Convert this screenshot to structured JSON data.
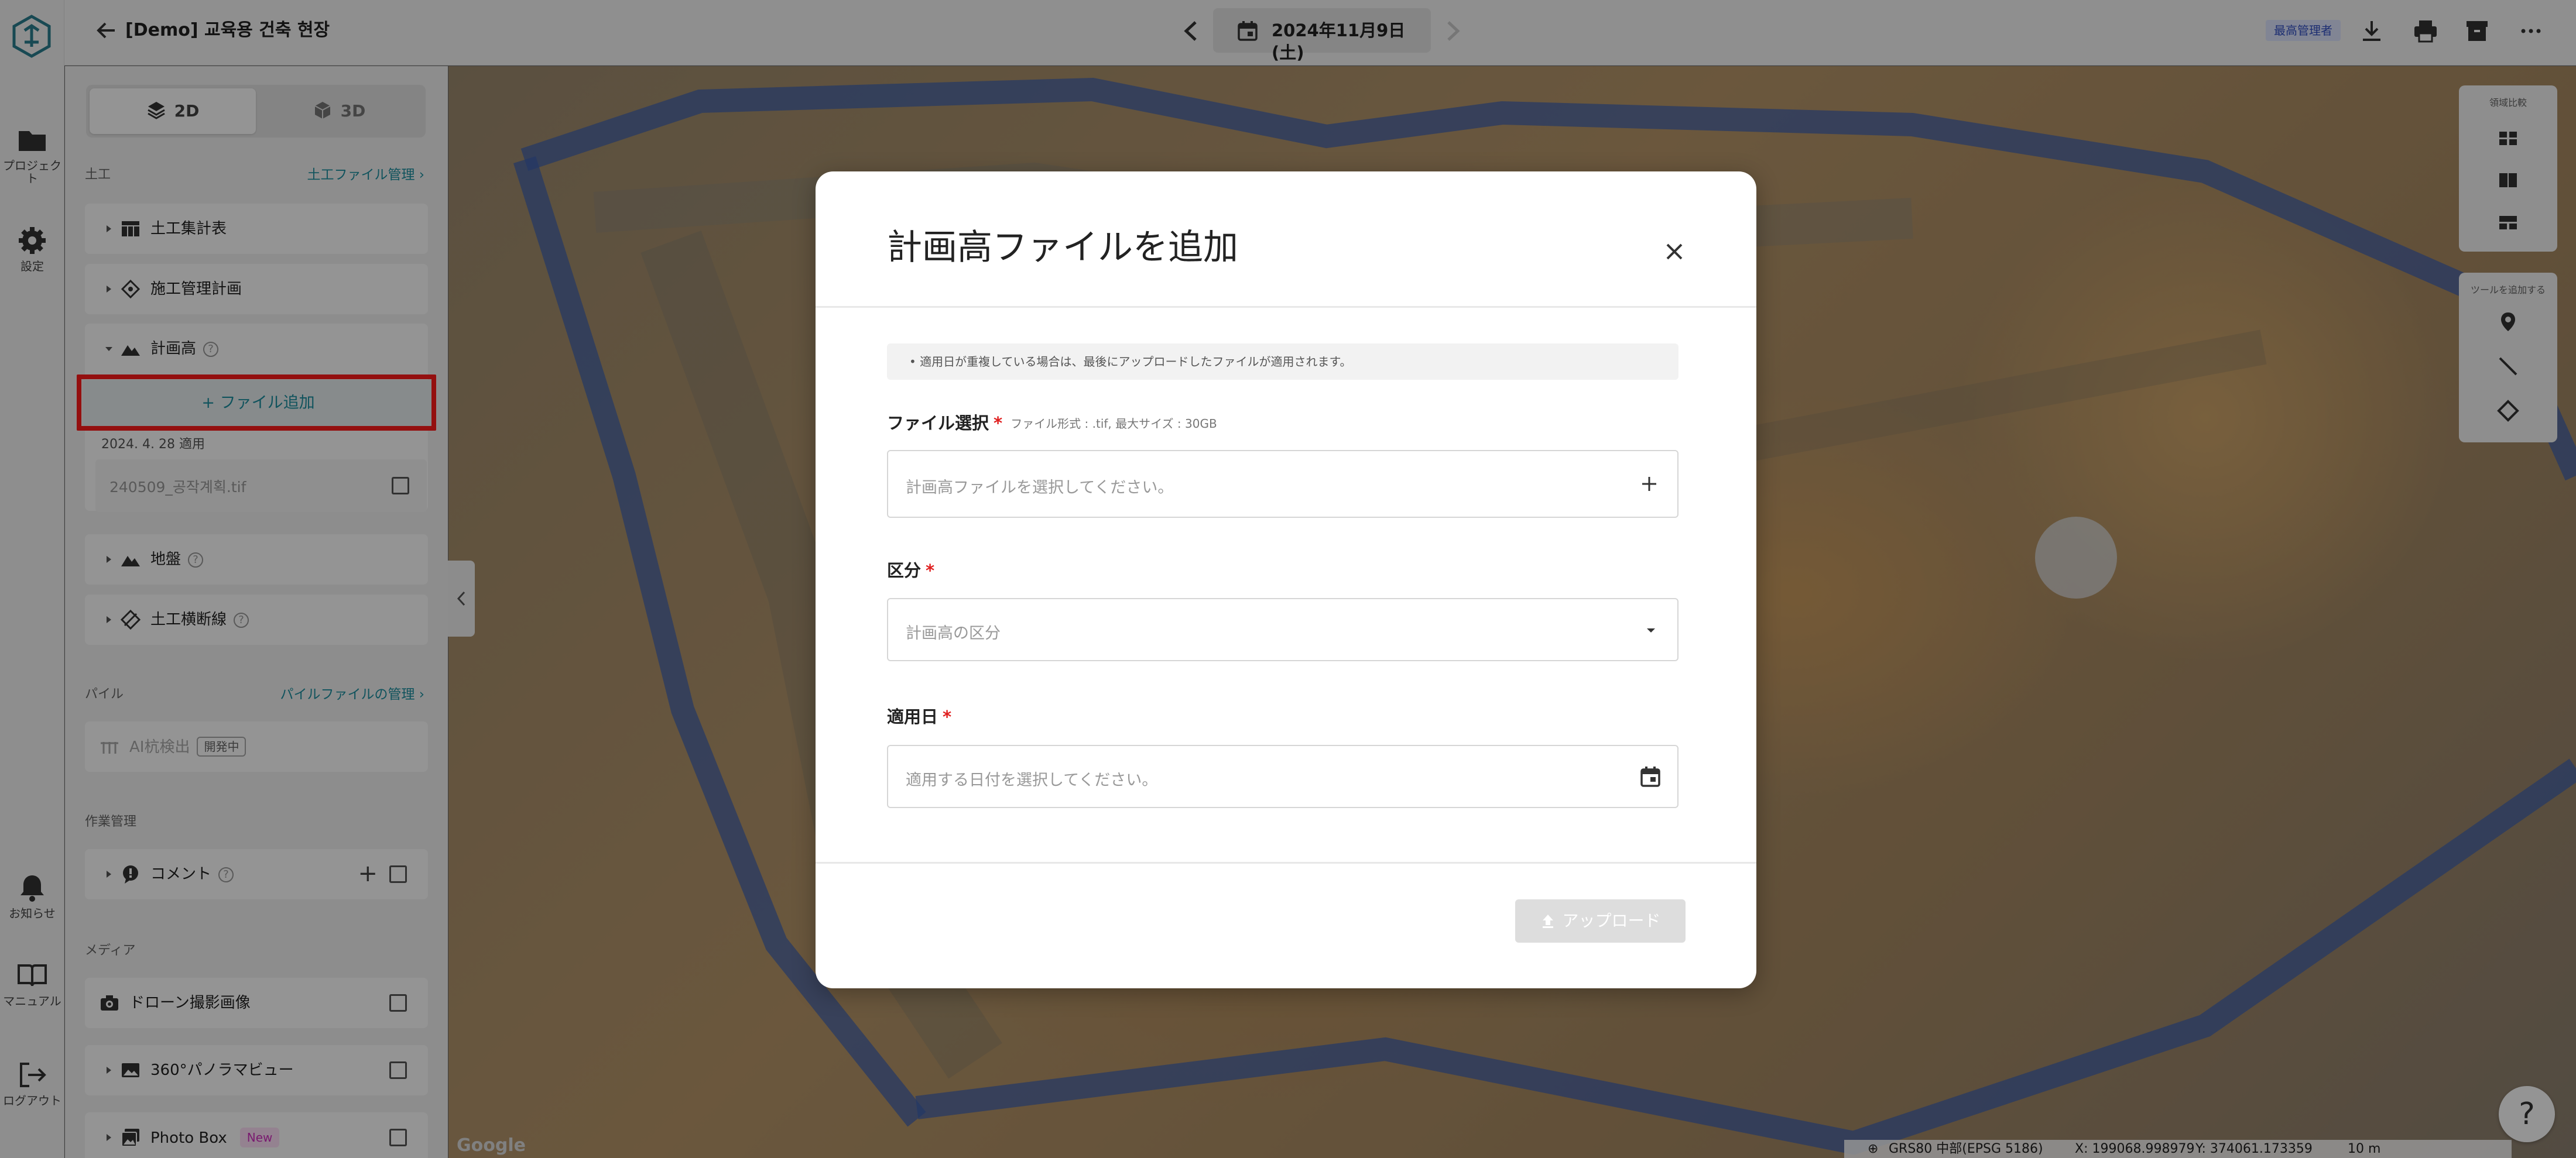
{
  "rail": {
    "projects": "プロジェクト",
    "settings": "設定",
    "notifications": "お知らせ",
    "manual": "マニュアル",
    "logout": "ログアウト"
  },
  "header": {
    "project_title": "[Demo] 교육용 건축 현장",
    "date": "2024年11月9日 (土)",
    "role_badge": "最高管理者"
  },
  "sidebar": {
    "view_2d": "2D",
    "view_3d": "3D",
    "earthwork": {
      "label": "土工",
      "link": "土工ファイル管理"
    },
    "items": {
      "summary": "土工集計表",
      "construction_plan": "施工管理計画",
      "design_height": "計画高",
      "ground": "地盤",
      "cross_section": "土工横断線"
    },
    "add_file": "+ ファイル追加",
    "applied_date": "2024. 4. 28 適用",
    "file_name": "240509_공작계획.tif",
    "pile": {
      "label": "パイル",
      "link": "パイルファイルの管理",
      "ai_detect": "AI杭検出",
      "dev_badge": "開発中"
    },
    "work": {
      "label": "作業管理",
      "comment": "コメント"
    },
    "media": {
      "label": "メディア",
      "drone": "ドローン撮影画像",
      "panorama": "360°パノラマビュー",
      "photobox": "Photo Box",
      "new_badge": "New"
    }
  },
  "map": {
    "compare_label": "領域比較",
    "tools_label": "ツールを追加する",
    "google": "Google",
    "crs": "GRS80 中部(EPSG 5186)",
    "x": "X: 199068.998979",
    "y": "Y: 374061.173359",
    "scale": "10 m",
    "help": "?"
  },
  "modal": {
    "title": "計画高ファイルを追加",
    "notice": "• 適用日が重複している場合は、最後にアップロードしたファイルが適用されます。",
    "file_label": "ファイル選択",
    "file_hint": "ファイル形式 : .tif, 最大サイズ : 30GB",
    "file_placeholder": "計画高ファイルを選択してください。",
    "category_label": "区分",
    "category_placeholder": "計画高の区分",
    "date_label": "適用日",
    "date_placeholder": "適用する日付を選択してください。",
    "required_mark": "*",
    "upload": "アップロード"
  }
}
